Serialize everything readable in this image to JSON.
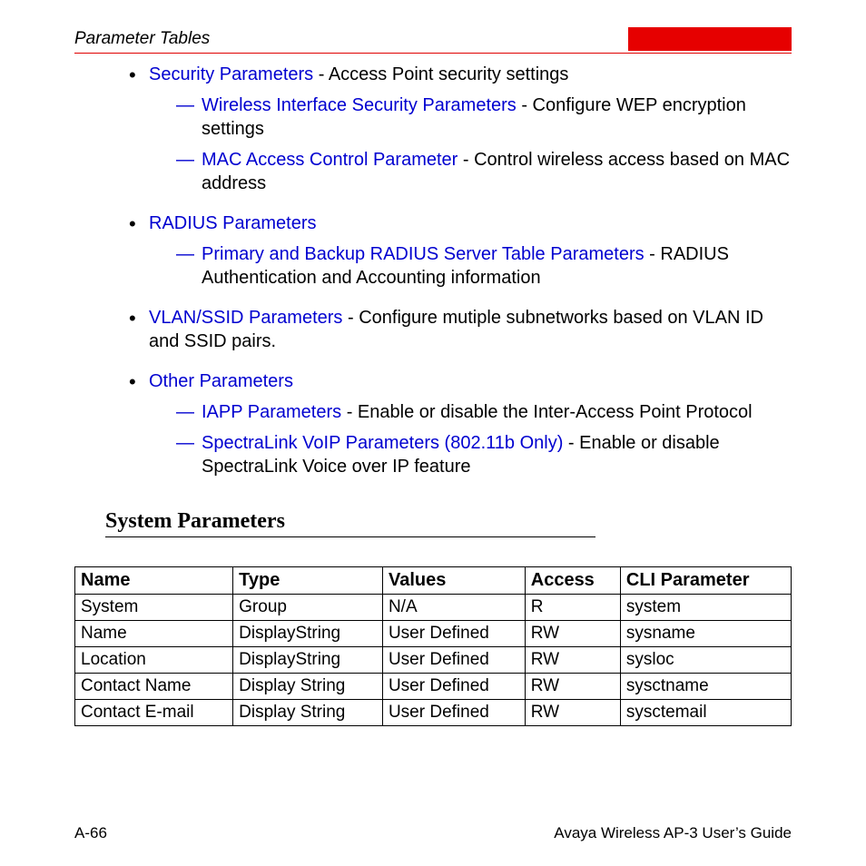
{
  "header": {
    "title": "Parameter Tables"
  },
  "bullets": [
    {
      "link": "Security Parameters",
      "desc": " - Access Point security settings",
      "sub": [
        {
          "link": "Wireless Interface Security Parameters",
          "desc": " - Configure WEP encryption settings"
        },
        {
          "link": "MAC Access Control Parameter",
          "desc": " - Control wireless access based on MAC address"
        }
      ]
    },
    {
      "link": "RADIUS Parameters",
      "desc": "",
      "sub": [
        {
          "link": "Primary and Backup RADIUS Server Table Parameters",
          "desc": " - RADIUS Authentication and Accounting information"
        }
      ]
    },
    {
      "link": "VLAN/SSID Parameters",
      "desc": " - Configure mutiple subnetworks based on VLAN ID and SSID pairs.",
      "sub": []
    },
    {
      "link": "Other Parameters",
      "desc": "",
      "sub": [
        {
          "link": "IAPP Parameters",
          "desc": " - Enable or disable the Inter-Access Point Protocol"
        },
        {
          "link": "SpectraLink VoIP Parameters (802.11b Only)",
          "desc": " - Enable or disable SpectraLink Voice over IP feature"
        }
      ]
    }
  ],
  "section_heading": "System Parameters",
  "table": {
    "headers": [
      "Name",
      "Type",
      "Values",
      "Access",
      "CLI Parameter"
    ],
    "rows": [
      [
        "System",
        "Group",
        "N/A",
        "R",
        "system"
      ],
      [
        "Name",
        "DisplayString",
        "User Defined",
        "RW",
        "sysname"
      ],
      [
        "Location",
        "DisplayString",
        "User Defined",
        "RW",
        "sysloc"
      ],
      [
        "Contact Name",
        "Display String",
        "User Defined",
        "RW",
        "sysctname"
      ],
      [
        "Contact E-mail",
        "Display String",
        "User Defined",
        "RW",
        "sysctemail"
      ]
    ]
  },
  "footer": {
    "left": "A-66",
    "right": "Avaya Wireless AP-3 User’s Guide"
  }
}
